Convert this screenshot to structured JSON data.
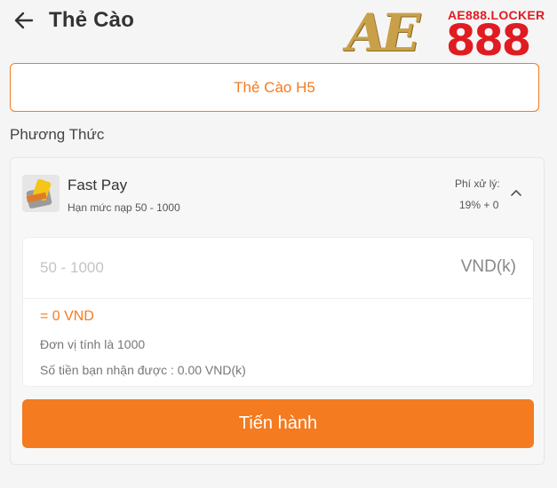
{
  "header": {
    "title": "Thẻ Cào",
    "back_icon": "arrow-left-icon"
  },
  "logo": {
    "brand": "AE",
    "number": "888",
    "domain": "AE888.LOCKER"
  },
  "tab": {
    "label": "Thẻ Cào H5"
  },
  "method_section": {
    "title": "Phương Thức"
  },
  "method": {
    "icon": "card-wallet-icon",
    "name": "Fast Pay",
    "limit_text": "Hạn mức nạp 50 - 1000",
    "fee_label": "Phí xử lý:",
    "fee_value": "19% + 0"
  },
  "amount": {
    "value": "",
    "placeholder": "50 - 1000",
    "unit": "VND(k)",
    "converted": "= 0 VND",
    "unit_note": "Đơn vị tính là 1000",
    "receive_note": "Số tiền bạn nhận được : 0.00 VND(k)"
  },
  "submit": {
    "label": "Tiến hành"
  },
  "colors": {
    "accent": "#f47b20",
    "logo_gold": "#c9a04a",
    "logo_red": "#e11b22",
    "background": "#f5f5f5"
  }
}
